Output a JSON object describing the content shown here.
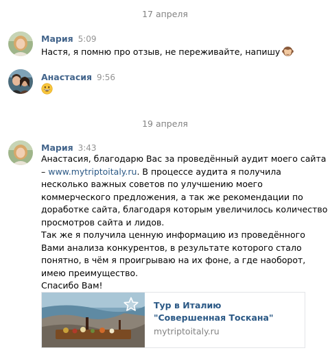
{
  "dates": [
    "17 апреля",
    "19 апреля"
  ],
  "messages": [
    {
      "author": "Мария",
      "time": "5:09",
      "text": "Настя, я помню про отзыв, не переживайте, напишу",
      "emoji": "see-no-evil-monkey"
    },
    {
      "author": "Анастасия",
      "time": "9:56",
      "emoji": "grinning-face"
    },
    {
      "author": "Мария",
      "time": "3:43",
      "lines": [
        "Анастасия, благодарю Вас за проведённый аудит моего сайта",
        "– ",
        ". В процессе аудита я получила",
        "несколько важных советов по улучшению моего",
        "коммерческого предложения, а так же рекомендации по",
        "доработке сайта, благодаря которым увеличилось количество",
        "просмотров сайта и лидов.",
        "Так же я получила ценную информацию из проведённого",
        "Вами анализа конкурентов, в результате которого стало",
        "понятно, в чём я проигрываю на их фоне, а где наоборот,",
        "имею преимущество.",
        "Спасибо Вам!"
      ],
      "link": "www.mytriptoitaly.ru",
      "snippet": {
        "title": "Тур в Италию \"Совершенная Тоскана\"",
        "domain": "mytriptoitaly.ru",
        "fav_icon": "star-icon"
      }
    }
  ],
  "colors": {
    "author": "#42648b",
    "link": "#2a5885",
    "meta": "#828282"
  }
}
